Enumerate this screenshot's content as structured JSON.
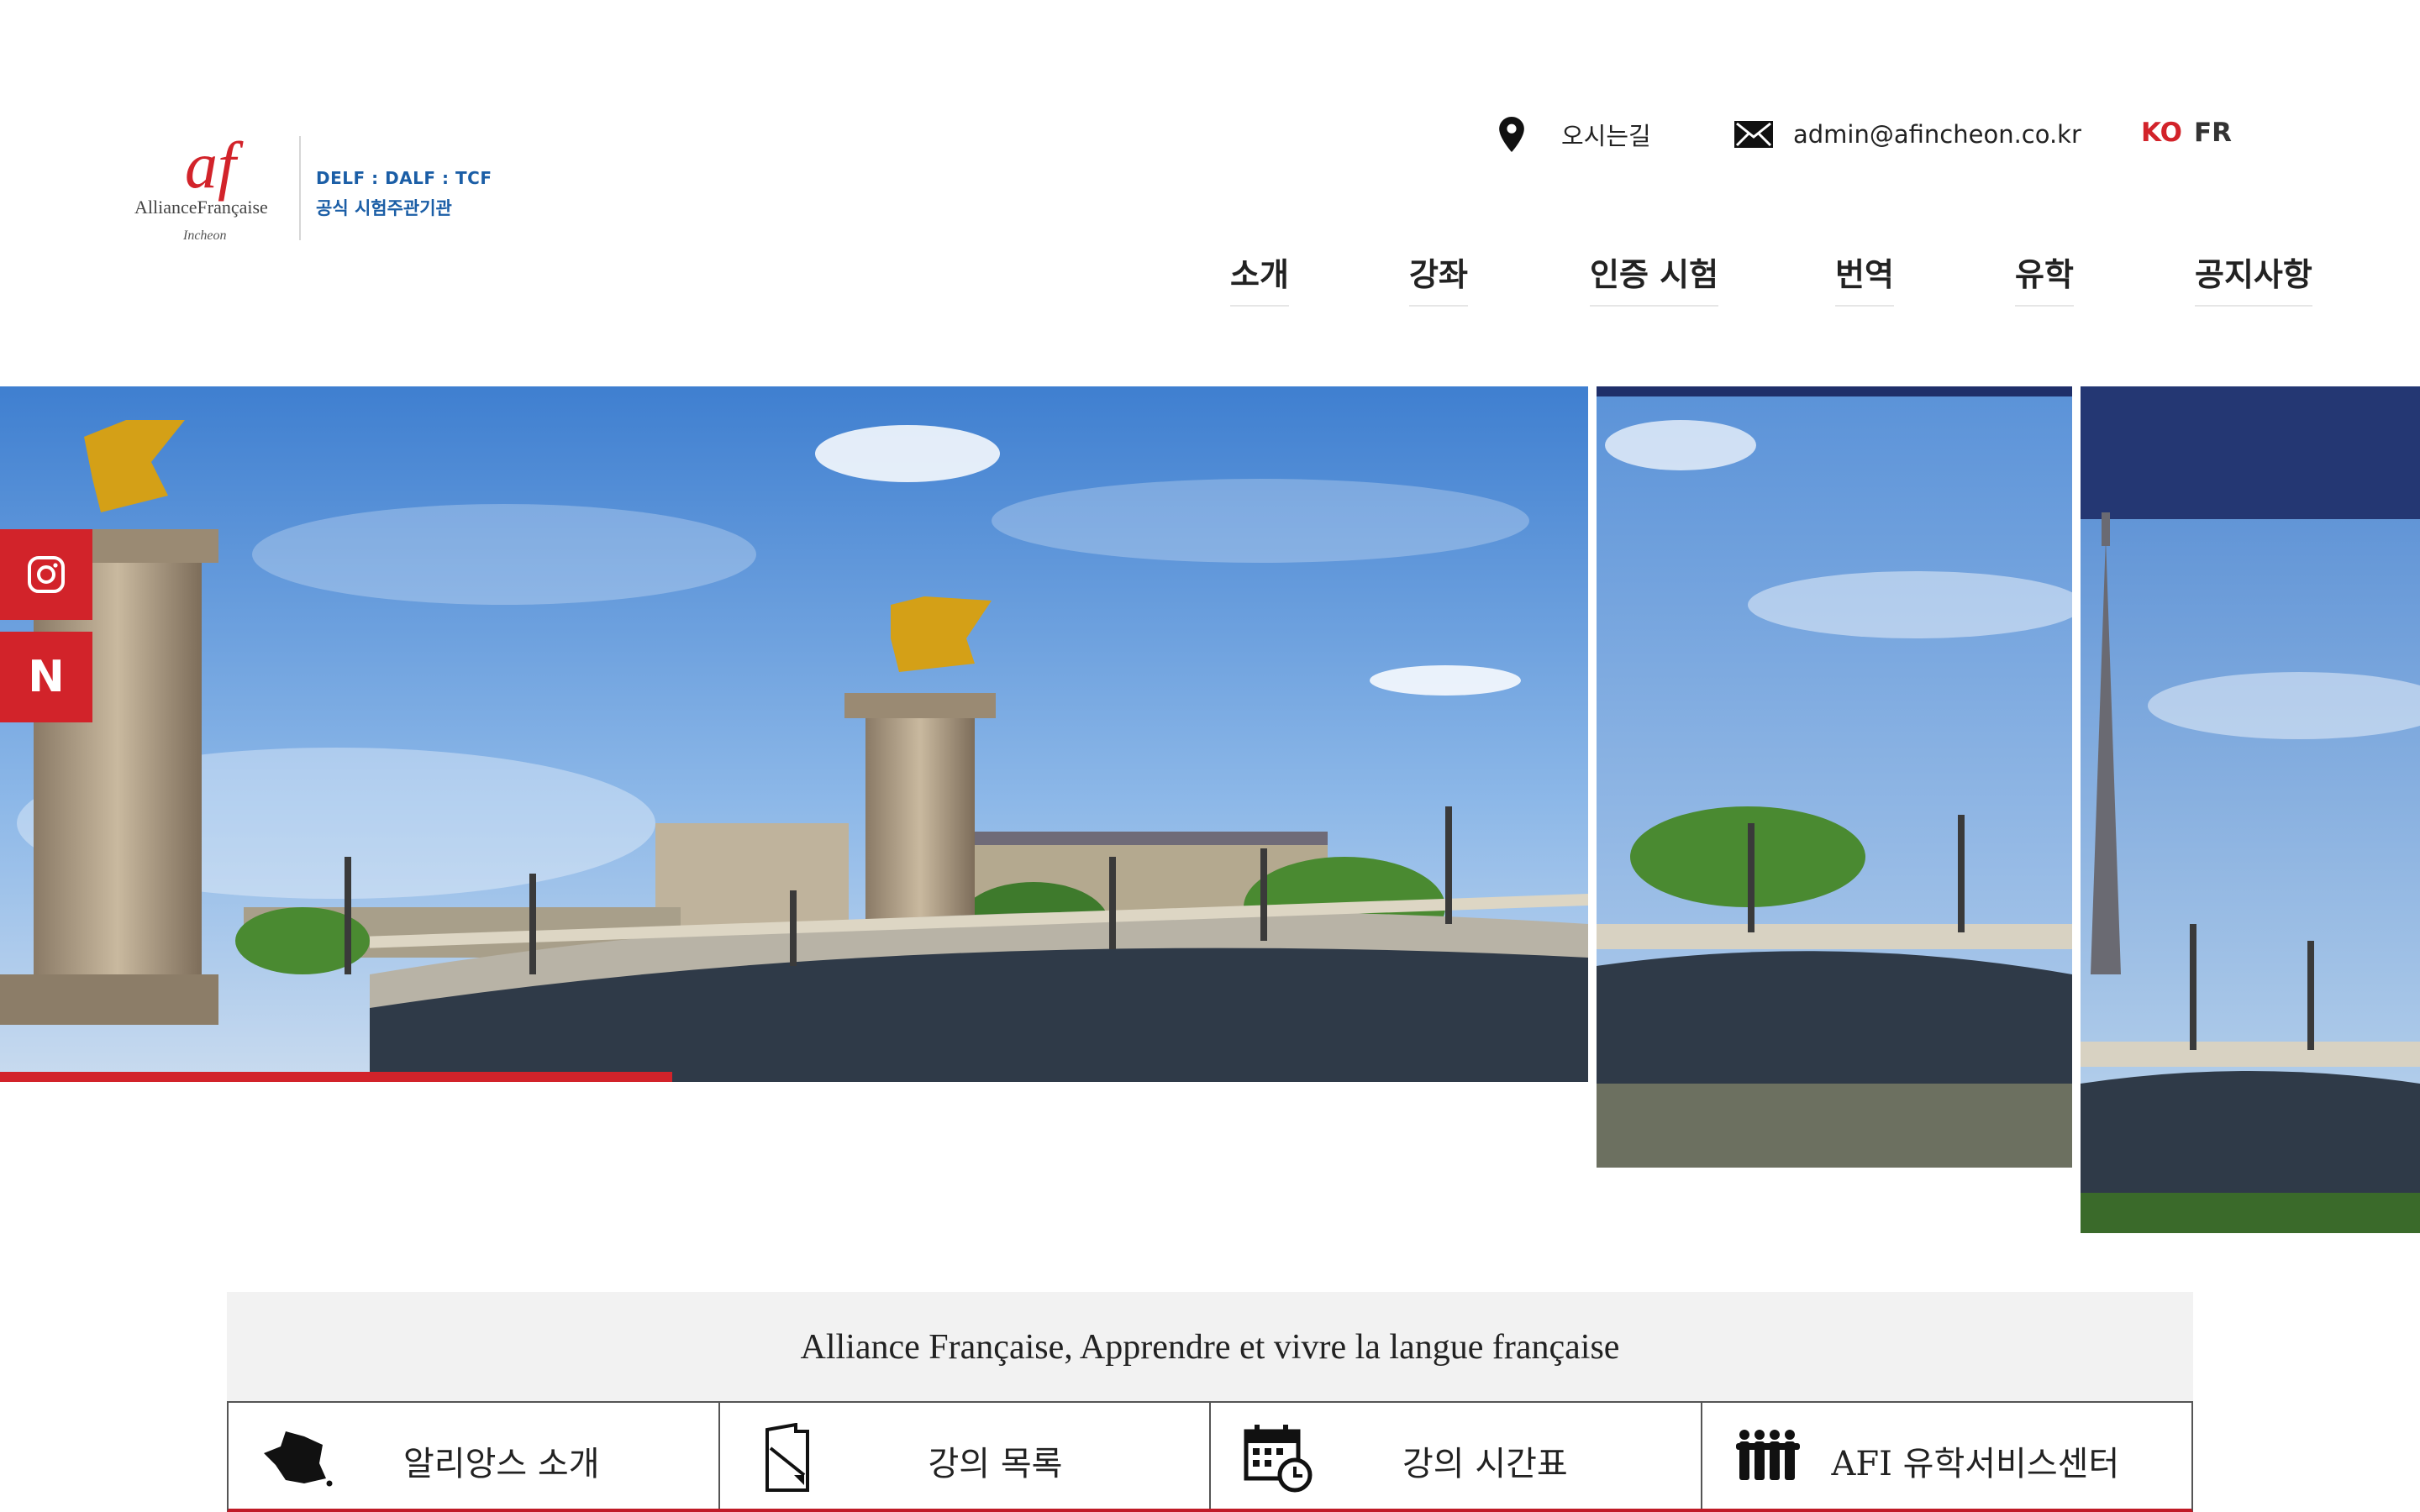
{
  "brand": {
    "logo_mark": "af",
    "logo_name": "AllianceFrançaise",
    "logo_city": "Incheon",
    "exams_line": "DELF ꞉ DALF ꞉ TCF",
    "official_line": "공식 시험주관기관"
  },
  "topbar": {
    "location_icon": "map-pin-icon",
    "location_label": "오시는길",
    "mail_icon": "envelope-icon",
    "email": "admin@afincheon.co.kr",
    "languages": [
      {
        "code": "KO",
        "active": true
      },
      {
        "code": "FR",
        "active": false
      }
    ]
  },
  "nav": {
    "items": [
      {
        "label": "소개"
      },
      {
        "label": "강좌"
      },
      {
        "label": "인증 시험"
      },
      {
        "label": "번역"
      },
      {
        "label": "유학"
      },
      {
        "label": "공지사항"
      }
    ]
  },
  "social": {
    "instagram_icon": "instagram-icon",
    "naver_icon": "naver-blog-icon",
    "naver_letter": "N"
  },
  "colors": {
    "accent": "#d2232a",
    "brand_blue": "#1b5ea6",
    "panel_bg": "#f2f2f2"
  },
  "quicklinks": {
    "tagline": "Alliance Française, Apprendre et vivre la langue française",
    "items": [
      {
        "label": "알리앙스 소개",
        "icon": "france-map-icon"
      },
      {
        "label": "강의 목록",
        "icon": "document-icon"
      },
      {
        "label": "강의 시간표",
        "icon": "calendar-clock-icon"
      },
      {
        "label": "AFI 유학서비스센터",
        "icon": "people-group-icon"
      }
    ]
  }
}
